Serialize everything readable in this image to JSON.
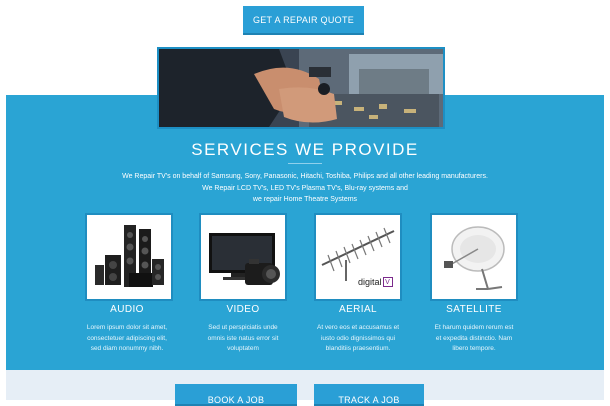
{
  "top": {
    "quote_label": "GET A REPAIR QUOTE"
  },
  "services": {
    "title": "SERVICES WE PROVIDE",
    "intro_lines": [
      "We Repair TV's on behalf of Samsung, Sony, Panasonic, Hitachi, Toshiba, Philips and all other leading manufacturers.",
      "We Repair LCD TV's, LED TV's Plasma TV's, Blu-ray systems and",
      "we repair Home Theatre Systems"
    ],
    "items": [
      {
        "title": "AUDIO",
        "desc": [
          "Lorem ipsum dolor sit amet,",
          "consectetuer adipiscing elit,",
          "sed diam nonummy nibh."
        ]
      },
      {
        "title": "VIDEO",
        "desc": [
          "Sed ut perspiciatis unde",
          "omnis iste natus error sit",
          "voluptatem"
        ]
      },
      {
        "title": "AERIAL",
        "desc": [
          "At vero eos et accusamus et",
          "iusto odio dignissimos qui",
          "blanditiis praesentium."
        ],
        "logo": "digital",
        "logo_badge": "V"
      },
      {
        "title": "SATELLITE",
        "desc": [
          "Et harum quidem rerum est",
          "et expedita distinctio. Nam",
          "libero tempore."
        ]
      }
    ]
  },
  "bottom": {
    "book_label": "BOOK A JOB",
    "track_label": "TRACK A JOB"
  },
  "colors": {
    "accent": "#2aa4d4",
    "button": "#2a9fd6",
    "band": "#e6eef6"
  }
}
